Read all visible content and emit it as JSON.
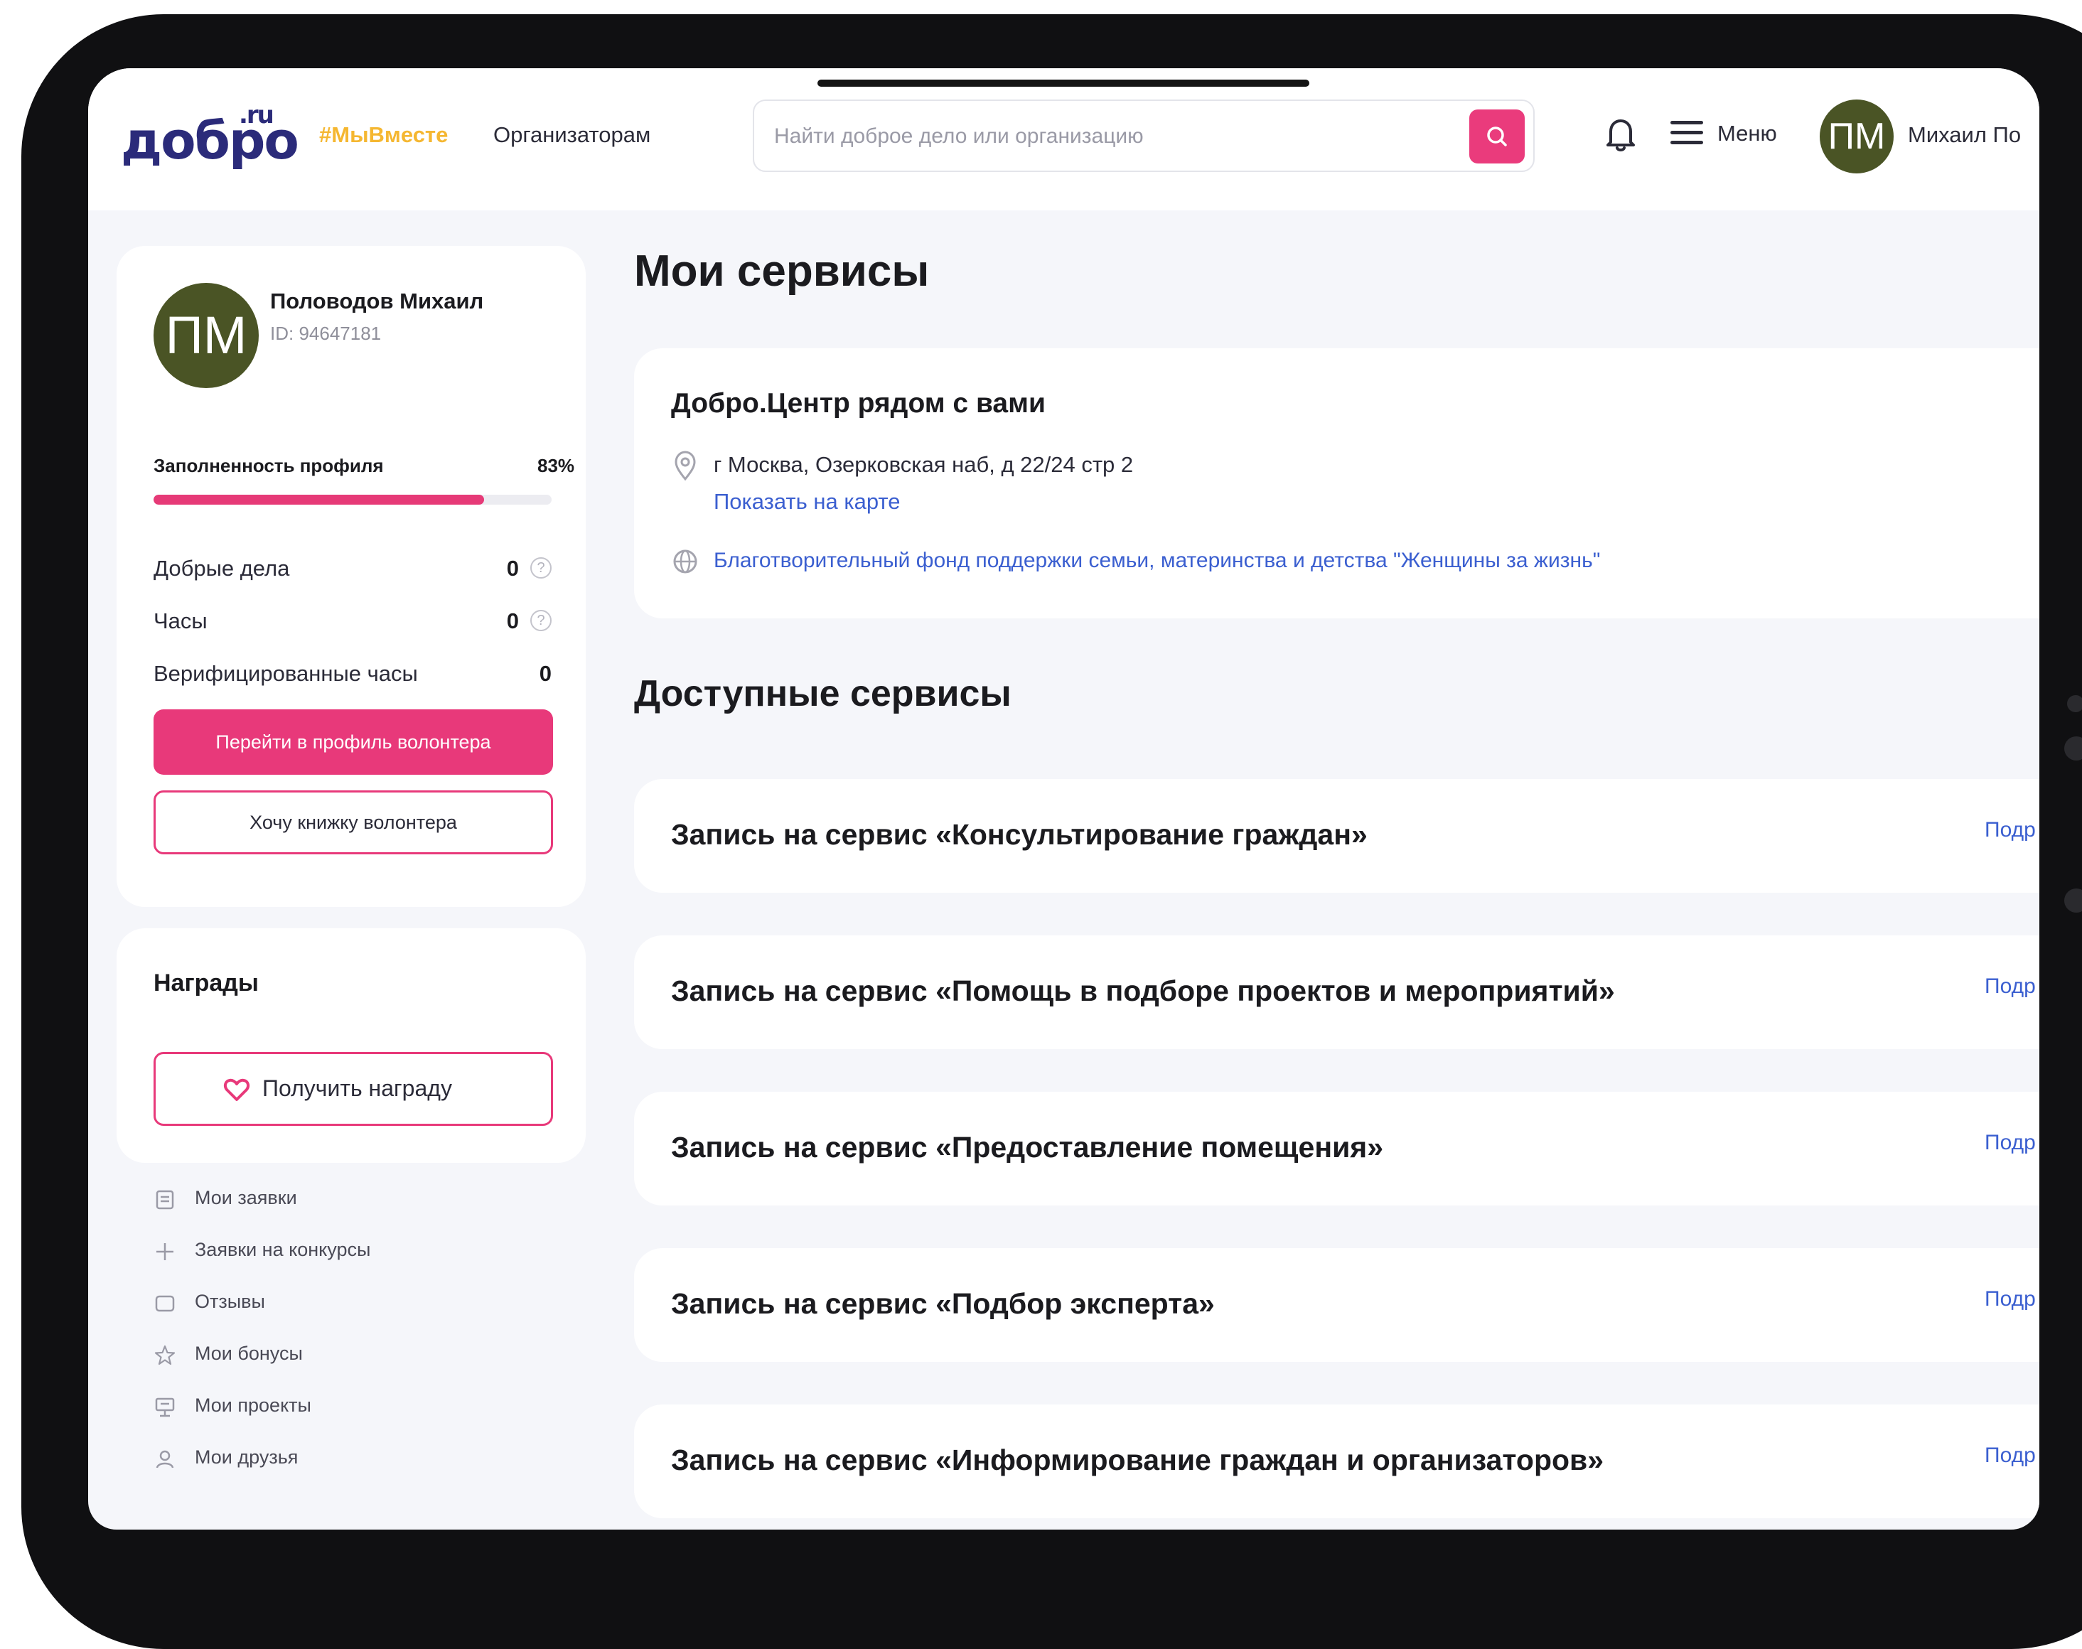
{
  "header": {
    "logo": "добро",
    "logo_suffix": ".ru",
    "nav_tag": "#МыВместе",
    "nav_organizers": "Организаторам",
    "search_placeholder": "Найти доброе дело или организацию",
    "menu_label": "Меню",
    "avatar_initials": "ПМ",
    "user_name": "Михаил По"
  },
  "profile": {
    "avatar_initials": "ПМ",
    "name": "Половодов Михаил",
    "id_text": "ID: 94647181",
    "fill_label": "Заполненность профиля",
    "fill_percent_text": "83%",
    "fill_fraction": 0.83,
    "stats": [
      {
        "label": "Добрые дела",
        "value": "0"
      },
      {
        "label": "Часы",
        "value": "0"
      },
      {
        "label": "Верифицированные часы",
        "value": "0"
      }
    ],
    "primary_button": "Перейти в профиль волонтера",
    "outline_button": "Хочу книжку волонтера"
  },
  "awards": {
    "title": "Награды",
    "button": "Получить награду"
  },
  "sidebar_links": [
    {
      "label": "Мои заявки",
      "icon": "document-icon"
    },
    {
      "label": "Заявки на конкурсы",
      "icon": "plus-icon"
    },
    {
      "label": "Отзывы",
      "icon": "comment-icon"
    },
    {
      "label": "Мои бонусы",
      "icon": "star-icon"
    },
    {
      "label": "Мои проекты",
      "icon": "project-icon"
    },
    {
      "label": "Мои друзья",
      "icon": "friends-icon"
    }
  ],
  "main": {
    "title": "Мои сервисы",
    "center": {
      "title": "Добро.Центр рядом с вами",
      "address": "г Москва, Озерковская наб, д 22/24 стр 2",
      "map_link": "Показать на карте",
      "org_link": "Благотворительный фонд поддержки семьи, материнства и детства \"Женщины за жизнь\""
    },
    "available_title": "Доступные сервисы",
    "services": [
      {
        "name": "Запись на сервис «Консультирование граждан»",
        "more": "Подр"
      },
      {
        "name": "Запись на сервис «Помощь в подборе проектов и мероприятий»",
        "more": "Подр"
      },
      {
        "name": "Запись на сервис «Предоставление помещения»",
        "more": "Подр"
      },
      {
        "name": "Запись на сервис «Подбор эксперта»",
        "more": "Подр"
      },
      {
        "name": "Запись на сервис «Информирование граждан и организаторов»",
        "more": "Подр"
      }
    ]
  },
  "colors": {
    "accent_pink": "#e8397a",
    "brand_navy": "#2b2b7a",
    "tag_yellow": "#f5b731",
    "link_blue": "#3b5fd0",
    "avatar_olive": "#4a5425"
  }
}
